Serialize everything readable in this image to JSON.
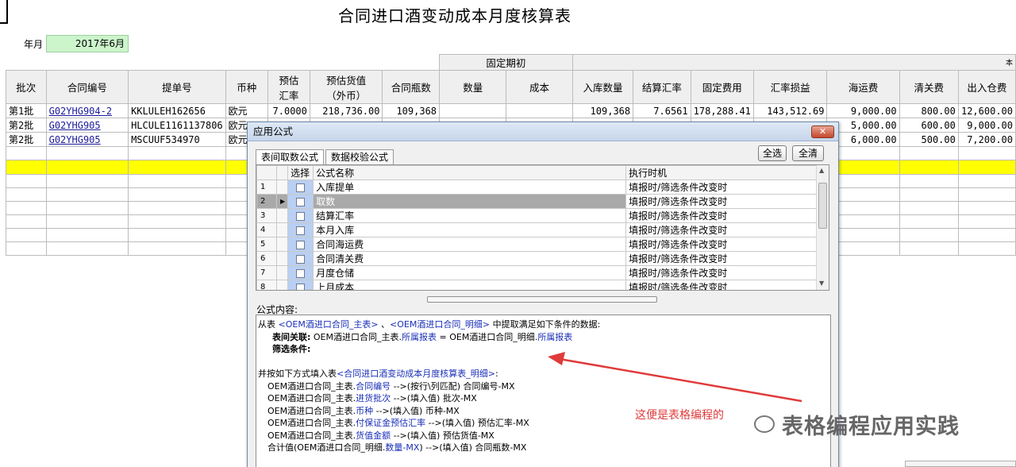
{
  "sheet_title": "合同进口酒变动成本月度核算表",
  "year_month": {
    "label": "年月",
    "value": "2017年6月"
  },
  "group_headers": {
    "opening": "固定期初",
    "cut": "本"
  },
  "columns": [
    "批次",
    "合同编号",
    "提单号",
    "币种",
    "预估汇率",
    "预估货值（外币）",
    "合同瓶数",
    "数量",
    "成本",
    "入库数量",
    "结算汇率",
    "固定费用",
    "汇率损益",
    "海运费",
    "清关费",
    "出入仓费"
  ],
  "col_est_rate": [
    "预估",
    "汇率"
  ],
  "col_est_value": [
    "预估货值",
    "（外币）"
  ],
  "rows": [
    {
      "batch": "第1批",
      "contract": "G02YHG904-2",
      "bl": "KKLULEH162656",
      "currency": "欧元",
      "est_rate": "7.0000",
      "est_value": "218,736.00",
      "bottles": "109,368",
      "qty": "",
      "cost": "",
      "in_qty": "109,368",
      "settle_rate": "7.6561",
      "fixed": "178,288.41",
      "fx_pl": "143,512.69",
      "freight": "9,000.00",
      "customs": "800.00",
      "warehouse": "12,600.00"
    },
    {
      "batch": "第2批",
      "contract": "G02YHG905",
      "bl": "HLCULE1161137806",
      "currency": "欧元",
      "est_rate": "",
      "est_value": "",
      "bottles": "",
      "qty": "",
      "cost": "",
      "in_qty": "",
      "settle_rate": "",
      "fixed": "",
      "fx_pl": "",
      "freight": "5,000.00",
      "customs": "600.00",
      "warehouse": "9,000.00"
    },
    {
      "batch": "第2批",
      "contract": "G02YHG905",
      "bl": "MSCUUF534970",
      "currency": "欧元",
      "est_rate": "",
      "est_value": "",
      "bottles": "",
      "qty": "",
      "cost": "",
      "in_qty": "",
      "settle_rate": "",
      "fixed": "",
      "fx_pl": "",
      "freight": "6,000.00",
      "customs": "500.00",
      "warehouse": "7,200.00"
    }
  ],
  "dialog": {
    "title": "应用公式",
    "close": "✕",
    "tabs": [
      "表间取数公式",
      "数据校验公式"
    ],
    "select_all": "全选",
    "clear_all": "全清",
    "list_headers": {
      "select": "选择",
      "name": "公式名称",
      "exec": "执行时机"
    },
    "items": [
      {
        "no": "1",
        "name": "入库提单",
        "exec": "填报时/筛选条件改变时"
      },
      {
        "no": "2",
        "name": "取数",
        "exec": "填报时/筛选条件改变时"
      },
      {
        "no": "3",
        "name": "结算汇率",
        "exec": "填报时/筛选条件改变时"
      },
      {
        "no": "4",
        "name": "本月入库",
        "exec": "填报时/筛选条件改变时"
      },
      {
        "no": "5",
        "name": "合同海运费",
        "exec": "填报时/筛选条件改变时"
      },
      {
        "no": "6",
        "name": "合同清关费",
        "exec": "填报时/筛选条件改变时"
      },
      {
        "no": "7",
        "name": "月度仓储",
        "exec": "填报时/筛选条件改变时"
      },
      {
        "no": "8",
        "name": "上月成本",
        "exec": "填报时/筛选条件改变时"
      }
    ],
    "content_label": "公式内容:",
    "content": {
      "l1_a": "从表 ",
      "l1_t1": "<OEM酒进口合同_主表>",
      "l1_b": " 、",
      "l1_t2": "<OEM酒进口合同_明细>",
      "l1_c": " 中提取满足如下条件的数据:",
      "l2_k": "表间关联:",
      "l2_a": " OEM酒进口合同_主表.",
      "l2_f1": "所属报表",
      "l2_b": " = OEM酒进口合同_明细.",
      "l2_f2": "所属报表",
      "l3_k": "筛选条件:",
      "l4_a": "并按如下方式填入表",
      "l4_t": "<合同进口酒变动成本月度核算表_明细>",
      "l4_b": ":",
      "m1_a": "OEM酒进口合同_主表.",
      "m1_f": "合同编号",
      "m1_b": "  -->(按行\\列匹配) 合同编号-MX",
      "m2_a": "OEM酒进口合同_主表.",
      "m2_f": "进货批次",
      "m2_b": "  -->(填入值) 批次-MX",
      "m3_a": "OEM酒进口合同_主表.",
      "m3_f": "币种",
      "m3_b": "  -->(填入值) 币种-MX",
      "m4_a": "OEM酒进口合同_主表.",
      "m4_f": "付保证金预估汇率",
      "m4_b": "  -->(填入值) 预估汇率-MX",
      "m5_a": "OEM酒进口合同_主表.",
      "m5_f": "货值金额",
      "m5_b": "  -->(填入值) 预估货值-MX",
      "m6_a": "合计值(OEM酒进口合同_明细.",
      "m6_f": "数量-MX",
      "m6_b": ")  -->(填入值) 合同瓶数-MX"
    }
  },
  "annotation": "这便是表格编程的",
  "watermark": "表格编程应用实践"
}
